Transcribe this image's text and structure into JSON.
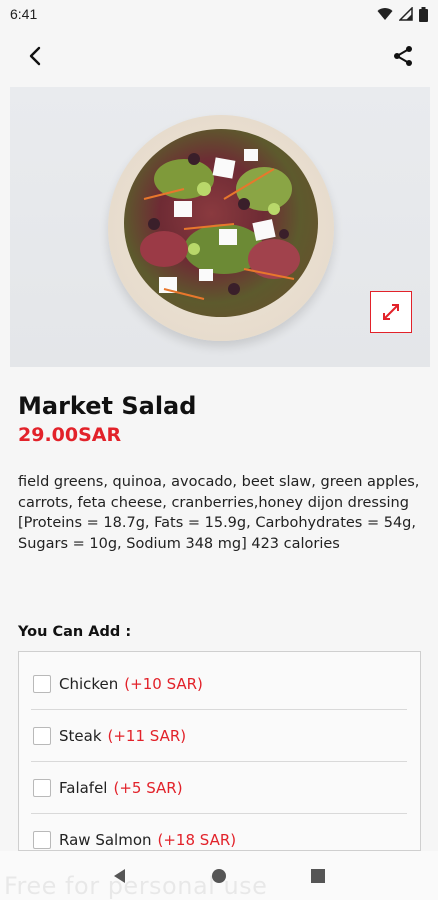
{
  "status_bar": {
    "time": "6:41"
  },
  "topbar": {
    "back_icon": "back-arrow-icon",
    "share_icon": "share-icon"
  },
  "product": {
    "name": "Market Salad",
    "price": "29.00SAR",
    "description": "field greens, quinoa, avocado, beet slaw, green apples, carrots, feta cheese, cranberries,honey dijon dressing [Proteins = 18.7g, Fats = 15.9g, Carbohydrates = 54g, Sugars = 10g, Sodium 348 mg] 423 calories"
  },
  "addons": {
    "title": "You Can Add :",
    "items": [
      {
        "name": "Chicken",
        "price": "(+10 SAR)"
      },
      {
        "name": "Steak",
        "price": "(+11 SAR)"
      },
      {
        "name": "Falafel",
        "price": "(+5 SAR)"
      },
      {
        "name": "Raw Salmon",
        "price": "(+18 SAR)"
      }
    ]
  },
  "watermark": "Free for personal use",
  "colors": {
    "accent": "#e2222a",
    "text": "#111111",
    "background": "#f6f6f6"
  }
}
